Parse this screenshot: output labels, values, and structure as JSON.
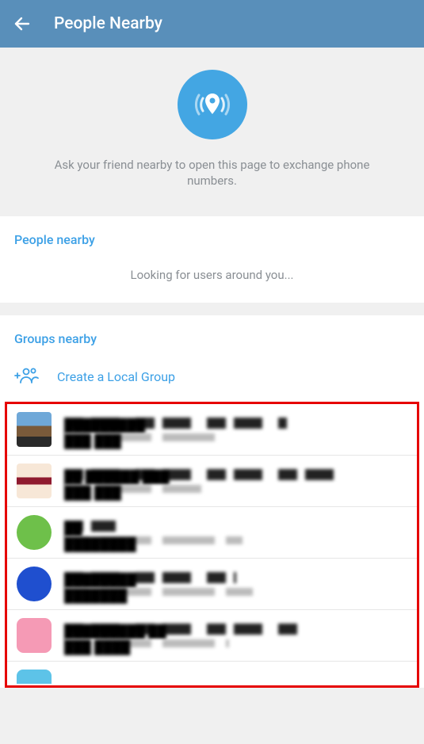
{
  "header": {
    "title": "People Nearby"
  },
  "hero": {
    "text": "Ask your friend nearby to open this page to exchange phone numbers."
  },
  "people": {
    "heading": "People nearby",
    "status": "Looking for users around you..."
  },
  "groups": {
    "heading": "Groups nearby",
    "create_label": "Create a Local Group",
    "items": [
      {
        "title": "█████████",
        "subtitle": "███ ███"
      },
      {
        "title": "██ ██████ ███",
        "subtitle": "███ ███"
      },
      {
        "title": "██",
        "subtitle": "████████"
      },
      {
        "title": "████████",
        "subtitle": "███████"
      },
      {
        "title": "█████████ ██",
        "subtitle": "███ ████"
      },
      {
        "title": "",
        "subtitle": ""
      }
    ]
  }
}
